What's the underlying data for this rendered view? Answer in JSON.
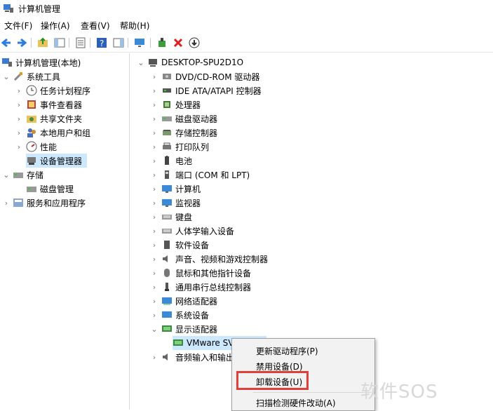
{
  "window": {
    "title": "计算机管理"
  },
  "menu": [
    "文件(F)",
    "操作(A)",
    "查看(V)",
    "帮助(H)"
  ],
  "left_tree": {
    "root": "计算机管理(本地)",
    "system_tools": "系统工具",
    "items": [
      "任务计划程序",
      "事件查看器",
      "共享文件夹",
      "本地用户和组",
      "性能",
      "设备管理器"
    ],
    "storage": "存储",
    "disk": "磁盘管理",
    "services": "服务和应用程序"
  },
  "device_tree": {
    "root": "DESKTOP-SPU2D1O",
    "categories": [
      "DVD/CD-ROM 驱动器",
      "IDE ATA/ATAPI 控制器",
      "处理器",
      "磁盘驱动器",
      "存储控制器",
      "打印队列",
      "电池",
      "端口 (COM 和 LPT)",
      "计算机",
      "监视器",
      "键盘",
      "人体学输入设备",
      "软件设备",
      "声音、视频和游戏控制器",
      "鼠标和其他指针设备",
      "通用串行总线控制器",
      "网络适配器",
      "系统设备",
      "显示适配器"
    ],
    "display_child": "VMware SVGA 3D",
    "audio": "音频输入和输出"
  },
  "context_menu": [
    "更新驱动程序(P)",
    "禁用设备(D)",
    "卸载设备(U)",
    "扫描检测硬件改动(A)"
  ],
  "watermark": "软件SOS",
  "colors": {
    "highlight_box": "#e0403a",
    "selection": "#cce8ff"
  }
}
